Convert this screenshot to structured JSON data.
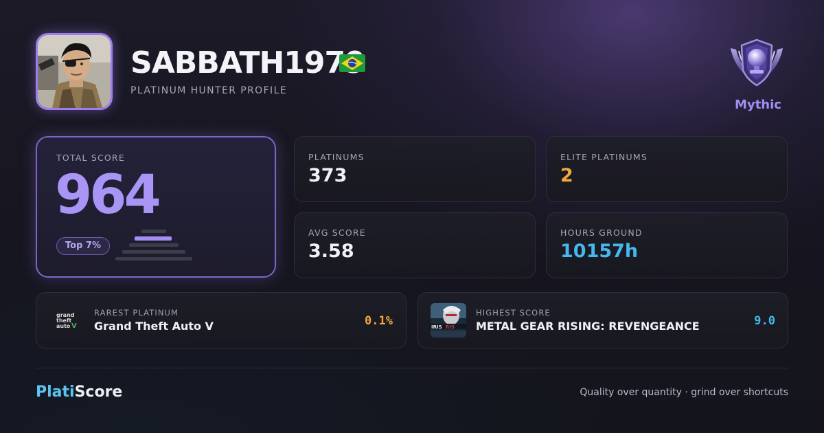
{
  "profile": {
    "username": "SABBATH1979",
    "country_flag": "Brazil flag",
    "subtitle": "PLATINUM HUNTER PROFILE",
    "tier": "Mythic",
    "tier_icon": "trophy-emblem-icon"
  },
  "total_score": {
    "label": "TOTAL SCORE",
    "value": "964",
    "rank": "Top 7%"
  },
  "stats": {
    "platinums": {
      "label": "PLATINUMS",
      "value": "373",
      "color": "#f1f2f6"
    },
    "elite_platinums": {
      "label": "ELITE PLATINUMS",
      "value": "2",
      "color": "#f2a93b"
    },
    "avg_score": {
      "label": "AVG SCORE",
      "value": "3.58",
      "color": "#f1f2f6"
    },
    "hours_ground": {
      "label": "HOURS GROUND",
      "value": "10157h",
      "color": "#46b8ee"
    }
  },
  "rarest": {
    "label": "RAREST PLATINUM",
    "title": "Grand Theft Auto V",
    "metric": "0.1%",
    "metric_color": "#f2a93b",
    "icon": "gta-v-logo-icon"
  },
  "highest": {
    "label": "HIGHEST SCORE",
    "title": "METAL GEAR RISING: REVENGEANCE",
    "metric": "9.0",
    "metric_color": "#46b8ee",
    "icon": "metal-gear-rising-cover-icon"
  },
  "footer": {
    "brand_part1": "Plati",
    "brand_part2": "Score",
    "tagline": "Quality over quantity · grind over shortcuts"
  },
  "colors": {
    "accent_purple": "#a995f5",
    "accent_blue": "#46b8ee",
    "accent_orange": "#f2a93b"
  }
}
